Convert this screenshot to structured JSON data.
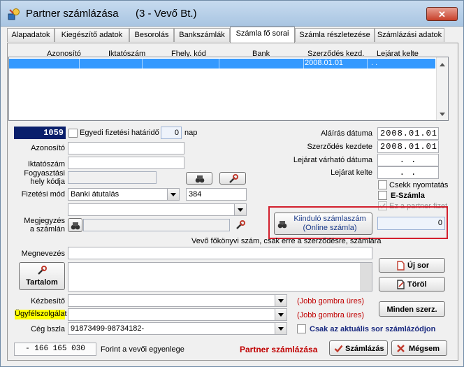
{
  "window": {
    "title": "Partner számlázása",
    "title_partner": "(3  -  Vevő Bt.)",
    "close_label": "✕"
  },
  "tabs": [
    {
      "label": "Alapadatok"
    },
    {
      "label": "Kiegészítő adatok"
    },
    {
      "label": "Besorolás"
    },
    {
      "label": "Bankszámlák"
    },
    {
      "label": "Számla fő sorai"
    },
    {
      "label": "Számla részletezése"
    },
    {
      "label": "Számlázási adatok"
    }
  ],
  "grid": {
    "columns": [
      "Azonosító",
      "Iktatószám",
      "Fhely. kód",
      "Bank",
      "Szerződés kezd.",
      "Lejárat kelte"
    ],
    "rows": [
      {
        "azonosito": "",
        "iktatoszam": "",
        "fhely": "",
        "bank": "",
        "szerzodes_kezd": "2008.01.01",
        "lejarat": " .  ."
      }
    ]
  },
  "form": {
    "record_id": "1059",
    "egyedi_label": "Egyedi fizetési határidő",
    "egyedi_value": "0",
    "nap_label": "nap",
    "azonosito_label": "Azonosító",
    "azonosito_value": "",
    "iktatoszam_label": "Iktatószám",
    "iktatoszam_value": "",
    "fogyasztasi_label1": "Fogyasztási",
    "fogyasztasi_label2": "hely kódja",
    "fogyasztasi_value": "",
    "fizetesi_mod_label": "Fizetési mód",
    "fizetesi_mod_value": "Banki átutalás",
    "fizetesi_code": "384",
    "combo_empty": "",
    "megjegyzes_label1": "Megjegyzés",
    "megjegyzes_label2": "a számlán",
    "megjegyzes_value": "",
    "alairas_label": "Aláírás dátuma",
    "alairas_value": "2008.01.01",
    "szerzodes_kezdete_label": "Szerződés kezdete",
    "szerzodes_kezdete_value": "2008.01.01",
    "lejarat_varhato_label": "Lejárat várható dátuma",
    "lejarat_varhato_value": ".  .",
    "lejarat_kelte_label": "Lejárat kelte",
    "lejarat_kelte_value": ".  .",
    "csekk_label": "Csekk nyomtatás",
    "eszamla_label": "E-Számla",
    "ez_partner_label": "Ez a partner fizet",
    "kiindulo_line1": "Kiinduló számlaszám",
    "kiindulo_line2": "(Online számla)",
    "kiindulo_value": "0",
    "vevo_note": "Vevő főkönyvi szám, csak erre a szerződésre, számlára",
    "megnevezes_label": "Megnevezés",
    "megnevezes_value": "",
    "tartalom_label": "Tartalom",
    "uj_sor_label": "Új sor",
    "torol_label": "Töröl",
    "kezbesito_label": "Kézbesítő",
    "kezbesito_hint": "(Jobb gombra üres)",
    "ugyfelszolgalat_label": "Ügyfélszolgálat",
    "ugyfelszolgalat_hint": "(Jobb gombra üres)",
    "minden_szerz_label": "Minden szerz.",
    "ceg_bszla_label": "Cég bszla",
    "ceg_bszla_value": "91873499-98734182-",
    "csak_aktualis_label": "Csak az aktuális sor számlázódjon"
  },
  "footer": {
    "balance_value": "- 166 165 030",
    "balance_label": "Forint a vevői egyenlege",
    "partner_label": "Partner számlázása",
    "szamlazas_label": "Számlázás",
    "megsem_label": "Mégsem"
  },
  "colors": {
    "accent_red": "#c00000",
    "selection_blue": "#3399ff",
    "id_box_navy": "#0a1f6b",
    "highlight_box": "#d21f2d",
    "ugyfel_yellow": "#ffff00"
  }
}
